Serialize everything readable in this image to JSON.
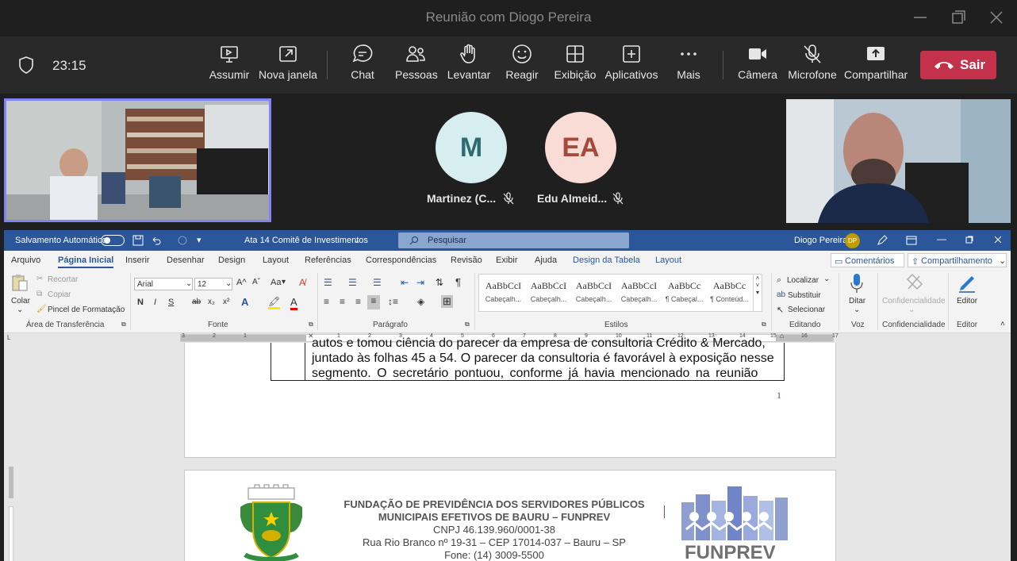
{
  "window": {
    "title": "Reunião com Diogo Pereira"
  },
  "toolbar": {
    "time": "23:15",
    "buttons": [
      {
        "label": "Assumir",
        "icon": "screen-share-icon"
      },
      {
        "label": "Nova janela",
        "icon": "pop-out-icon"
      },
      {
        "label": "Chat",
        "icon": "chat-icon"
      },
      {
        "label": "Pessoas",
        "icon": "people-icon"
      },
      {
        "label": "Levantar",
        "icon": "raise-hand-icon"
      },
      {
        "label": "Reagir",
        "icon": "smiley-icon"
      },
      {
        "label": "Exibição",
        "icon": "grid-icon"
      },
      {
        "label": "Aplicativos",
        "icon": "add-app-icon"
      },
      {
        "label": "Mais",
        "icon": "more-icon"
      },
      {
        "label": "Câmera",
        "icon": "camera-icon"
      },
      {
        "label": "Microfone",
        "icon": "mic-off-icon"
      },
      {
        "label": "Compartilhar",
        "icon": "share-icon"
      }
    ],
    "leave_label": "Sair",
    "leave_color": "#c4314b"
  },
  "participants": [
    {
      "initials": "M",
      "name": "Martinez (C...",
      "bg": "#d6eef0",
      "fg": "#2d6b73",
      "muted": true
    },
    {
      "initials": "EA",
      "name": "Edu Almeid...",
      "bg": "#fadcd7",
      "fg": "#a34a3c",
      "muted": true
    }
  ],
  "word": {
    "autosave_label": "Salvamento Automático",
    "doc_title": "Ata 14 Comitê de Investimentos",
    "search_placeholder": "Pesquisar",
    "user_name": "Diogo Pereira",
    "user_initials": "DP",
    "tabs": [
      "Arquivo",
      "Página Inicial",
      "Inserir",
      "Desenhar",
      "Design",
      "Layout",
      "Referências",
      "Correspondências",
      "Revisão",
      "Exibir",
      "Ajuda",
      "Design da Tabela",
      "Layout"
    ],
    "comments_label": "Comentários",
    "share_label": "Compartilhamento",
    "clipboard": {
      "paste": "Colar",
      "cut": "Recortar",
      "copy": "Copiar",
      "format_painter": "Pincel de Formatação",
      "group": "Área de Transferência"
    },
    "font": {
      "name": "Arial",
      "size": "12",
      "group": "Fonte",
      "case": "Aa",
      "bold": "N",
      "italic": "I",
      "underline": "S",
      "strike": "ab",
      "sub": "x₂",
      "sup": "x²"
    },
    "paragraph": {
      "group": "Paragrafo_label",
      "label": "Parágrafo"
    },
    "styles": {
      "group": "Estilos",
      "items": [
        {
          "preview": "AaBbCcI",
          "name": "Cabeçalh..."
        },
        {
          "preview": "AaBbCcI",
          "name": "Cabeçalh..."
        },
        {
          "preview": "AaBbCcI",
          "name": "Cabeçalh..."
        },
        {
          "preview": "AaBbCcI",
          "name": "Cabeçalh..."
        },
        {
          "preview": "AaBbCc",
          "name": "¶ Cabeçal..."
        },
        {
          "preview": "AaBbCc",
          "name": "¶ Conteúd..."
        }
      ]
    },
    "editing": {
      "find": "Localizar",
      "replace": "Substituir",
      "select": "Selecionar",
      "group": "Editando"
    },
    "voice": {
      "dictate": "Ditar",
      "group": "Voz"
    },
    "sensitivity": {
      "label": "Confidencialidade",
      "group": "Confidencialidade"
    },
    "editor": {
      "label": "Editor",
      "group": "Editor"
    },
    "ruler_numbers": [
      "3",
      "2",
      "1",
      "1",
      "2",
      "3",
      "4",
      "5",
      "6",
      "7",
      "8",
      "9",
      "10",
      "11",
      "12",
      "13",
      "14",
      "15",
      "16",
      "17"
    ]
  },
  "document": {
    "page1_lines": [
      "autos e tomou ciência do parecer da empresa de consultoria Crédito & Mercado,",
      "juntado às folhas 45 a 54. O parecer da consultoria é favorável à exposição nesse",
      "segmento.  O  secretário  pontuou,  conforme  já  havia  mencionado  na  reunião"
    ],
    "page_number": "1",
    "header_lines": [
      "FUNDAÇÃO DE PREVIDÊNCIA DOS SERVIDORES PÚBLICOS",
      "MUNICIPAIS EFETIVOS DE BAURU – FUNPREV",
      "CNPJ 46.139.960/0001-38",
      "Rua Rio Branco nº 19-31 – CEP 17014-037 – Bauru – SP",
      "Fone: (14) 3009-5500"
    ],
    "logo_text": "FUNPREV"
  }
}
